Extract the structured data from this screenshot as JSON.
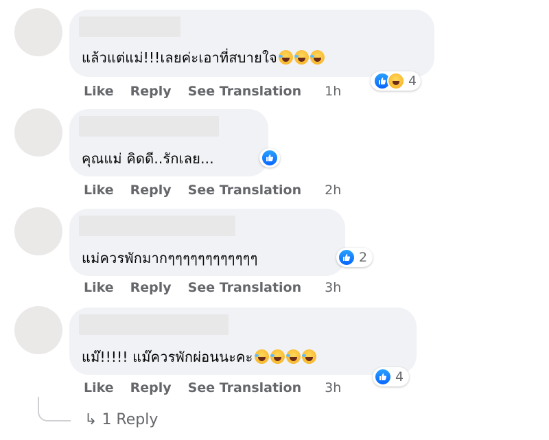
{
  "comments": [
    {
      "text": "แล้วแต่แม่!!!เลยค่ะเอาที่สบายใจ",
      "emoji": [
        "face-with-tears-of-joy",
        "face-with-tears-of-joy",
        "face-with-tears-of-joy"
      ],
      "reactions": [
        "like-icon",
        "haha-icon"
      ],
      "reaction_count": "4",
      "actions": {
        "like": "Like",
        "reply": "Reply",
        "translate": "See Translation",
        "time": "1h"
      }
    },
    {
      "text": "คุณแม่ คิดดี..รักเลย...",
      "reactions": [
        "like-icon"
      ],
      "reaction_count": "",
      "actions": {
        "like": "Like",
        "reply": "Reply",
        "translate": "See Translation",
        "time": "2h"
      }
    },
    {
      "text": "แม่ควรพักมากๆๆๆๆๆๆๆๆๆๆๆๆ",
      "reactions": [
        "like-icon"
      ],
      "reaction_count": "2",
      "actions": {
        "like": "Like",
        "reply": "Reply",
        "translate": "See Translation",
        "time": "3h"
      }
    },
    {
      "text": "แม๊!!!!! แม๊ควรพักผ่อนนะคะ",
      "emoji": [
        "face-with-tears-of-joy",
        "face-with-tears-of-joy",
        "face-with-tears-of-joy",
        "face-with-tears-of-joy"
      ],
      "reactions": [
        "like-icon"
      ],
      "reaction_count": "4",
      "actions": {
        "like": "Like",
        "reply": "Reply",
        "translate": "See Translation",
        "time": "3h"
      }
    }
  ],
  "replies_link": {
    "arrow": "↳",
    "label": "1 Reply"
  },
  "colors": {
    "bubble": "#f0f2f5",
    "like_blue": "#0866ff",
    "meta_text": "#65676b"
  }
}
